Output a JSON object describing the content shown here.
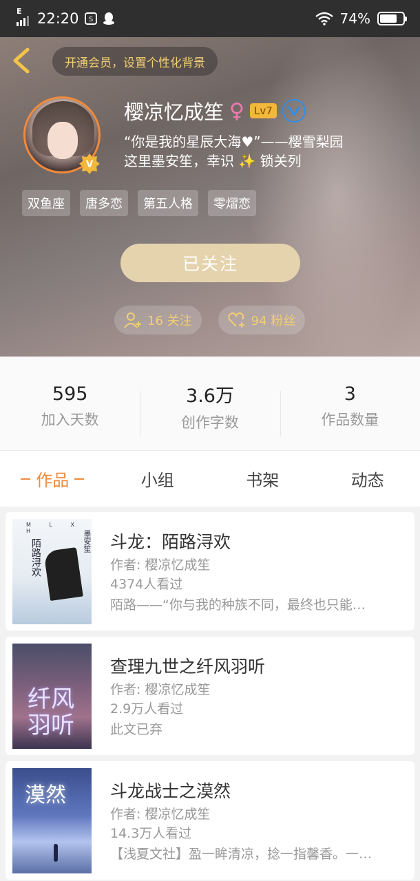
{
  "status_bar": {
    "network": "E",
    "time": "22:20",
    "battery_text": "74%",
    "battery_level": 0.74
  },
  "profile": {
    "vip_banner": "开通会员，设置个性化背景",
    "username": "樱凉忆成笙",
    "gender_symbol": "♀",
    "level": "Lv7",
    "bio_line1": "“你是我的星辰大海♥”——樱雪梨园",
    "bio_line2": "这里墨安笙，幸识 ✨ 锁关列",
    "tags": [
      "双鱼座",
      "唐多恋",
      "第五人格",
      "零熠恋"
    ],
    "follow_button": "已关注",
    "following": "16 关注",
    "fans": "94 粉丝"
  },
  "stats": [
    {
      "value": "595",
      "label": "加入天数"
    },
    {
      "value": "3.6万",
      "label": "创作字数"
    },
    {
      "value": "3",
      "label": "作品数量"
    }
  ],
  "tabs": [
    {
      "label": "作品",
      "active": true
    },
    {
      "label": "小组",
      "active": false
    },
    {
      "label": "书架",
      "active": false
    },
    {
      "label": "动态",
      "active": false
    }
  ],
  "works": [
    {
      "title": "斗龙：陌路浔欢",
      "author": "作者: 樱凉忆成笙",
      "views": "4374人看过",
      "desc": "陌路——“你与我的种族不同，最终也只能…",
      "cover_text": "陌路浔欢",
      "cover_top": "M L X H",
      "cover_author": "墨安笙"
    },
    {
      "title": "查理九世之纤风羽听",
      "author": "作者: 樱凉忆成笙",
      "views": "2.9万人看过",
      "desc": "此文已弃",
      "cover_text": "纤风羽听"
    },
    {
      "title": "斗龙战士之漠然",
      "author": "作者: 樱凉忆成笙",
      "views": "14.3万人看过",
      "desc": "【浅夏文社】盈一眸清凉，捻一指馨香。一…",
      "cover_text": "漠然"
    }
  ],
  "colors": {
    "accent": "#f08a3c",
    "gold": "#f2cf72",
    "follow_button_bg": "#e4d3ad",
    "verified_blue": "#2f8fe8"
  },
  "icons": [
    "back-arrow-icon",
    "vip-crown-icon",
    "verified-icon",
    "user-add-icon",
    "heart-add-icon",
    "wifi-icon",
    "battery-icon",
    "signal-icon",
    "notification-icon"
  ]
}
